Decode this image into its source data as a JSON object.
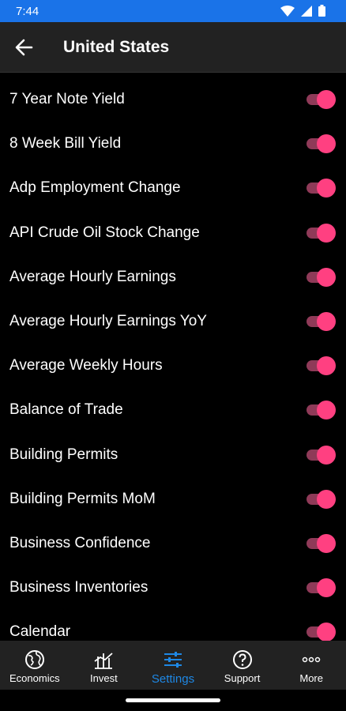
{
  "status_bar": {
    "time": "7:44"
  },
  "header": {
    "title": "United States"
  },
  "list_items": [
    {
      "label": "7 Year Note Yield",
      "enabled": true
    },
    {
      "label": "8 Week Bill Yield",
      "enabled": true
    },
    {
      "label": "Adp Employment Change",
      "enabled": true
    },
    {
      "label": "API Crude Oil Stock Change",
      "enabled": true
    },
    {
      "label": "Average Hourly Earnings",
      "enabled": true
    },
    {
      "label": "Average Hourly Earnings YoY",
      "enabled": true
    },
    {
      "label": "Average Weekly Hours",
      "enabled": true
    },
    {
      "label": "Balance of Trade",
      "enabled": true
    },
    {
      "label": "Building Permits",
      "enabled": true
    },
    {
      "label": "Building Permits MoM",
      "enabled": true
    },
    {
      "label": "Business Confidence",
      "enabled": true
    },
    {
      "label": "Business Inventories",
      "enabled": true
    },
    {
      "label": "Calendar",
      "enabled": true
    }
  ],
  "bottom_nav": {
    "items": [
      {
        "label": "Economics",
        "icon": "globe-icon"
      },
      {
        "label": "Invest",
        "icon": "chart-icon"
      },
      {
        "label": "Settings",
        "icon": "sliders-icon",
        "active": true
      },
      {
        "label": "Support",
        "icon": "help-icon"
      },
      {
        "label": "More",
        "icon": "more-icon"
      }
    ]
  },
  "colors": {
    "status_bar": "#1a73e8",
    "toggle_on": "#ff4081",
    "active_nav": "#1e88e5"
  }
}
